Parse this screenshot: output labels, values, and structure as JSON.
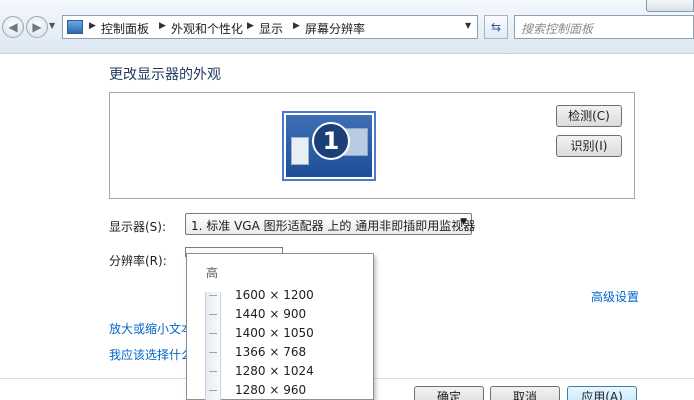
{
  "address": {
    "back_icon": "back-arrow-icon",
    "forward_icon": "forward-arrow-icon",
    "crumbs": [
      "控制面板",
      "外观和个性化",
      "显示",
      "屏幕分辨率"
    ],
    "search_placeholder": "搜索控制面板"
  },
  "main": {
    "title": "更改显示器的外观",
    "monitor_number": "1",
    "detect_label": "检测(C)",
    "identify_label": "识别(I)",
    "display_label": "显示器(S):",
    "display_value": "1. 标准 VGA 图形适配器 上的 通用非即插即用监视器",
    "resolution_label": "分辨率(R):",
    "advanced_link": "高级设置",
    "link_text_size": "放大或缩小文本",
    "link_which": "我应该选择什么"
  },
  "resolution_dropdown": {
    "high_label": "高",
    "options": [
      "1600 × 1200",
      "1440 × 900",
      "1400 × 1050",
      "1366 × 768",
      "1280 × 1024",
      "1280 × 960"
    ]
  },
  "footer": {
    "ok_label": "确定",
    "cancel_label": "取消",
    "apply_label": "应用(A)"
  }
}
